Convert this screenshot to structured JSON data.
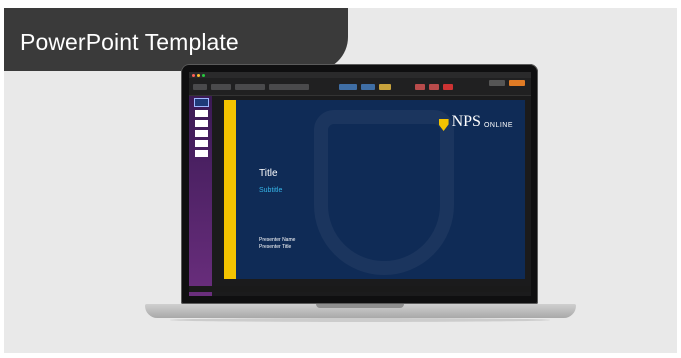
{
  "banner": {
    "label": "PowerPoint Template"
  },
  "slide": {
    "logo_main": "NPS",
    "logo_sub": "ONLINE",
    "title": "Title",
    "subtitle": "Subtitle",
    "presenter_name": "Presenter Name",
    "presenter_title": "Presenter Title"
  },
  "colors": {
    "banner_bg": "#3a3a3a",
    "slide_bg": "#0f2b56",
    "accent_gold": "#f3c300",
    "subtitle_blue": "#35b5e8",
    "panel_purple": "#6a2e7d"
  }
}
